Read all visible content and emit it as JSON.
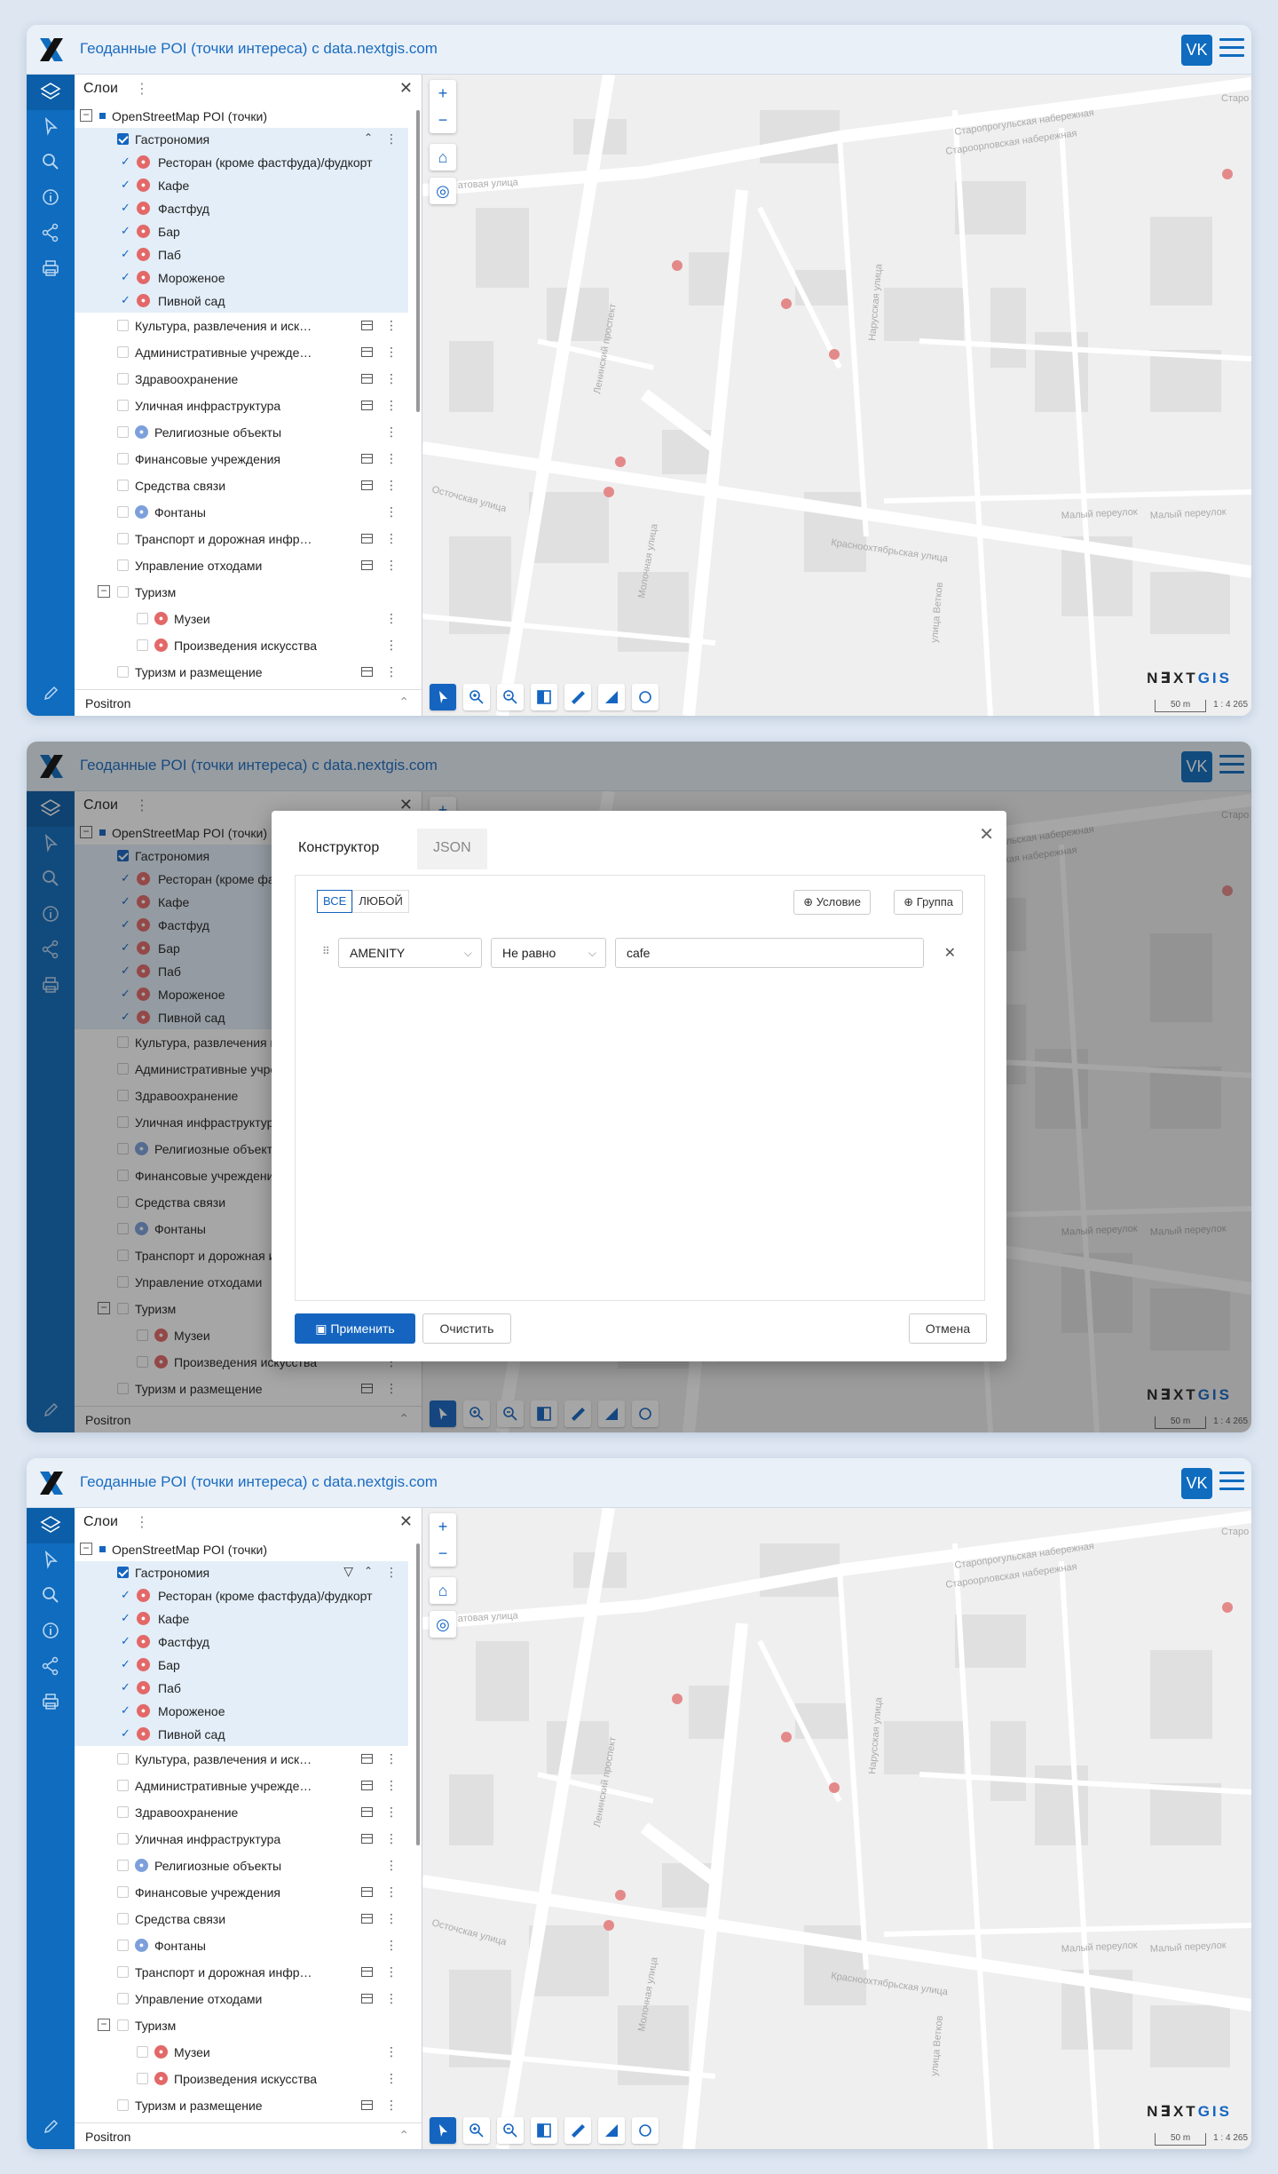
{
  "app": {
    "title": "Геоданные POI (точки интереса) с data.nextgis.com",
    "vk_label": "VK",
    "brand_color": "#0f6cbf"
  },
  "layers_panel": {
    "title": "Слои",
    "root": "OpenStreetMap POI (точки)",
    "group": "Гастрономия",
    "children": [
      {
        "label": "Ресторан (кроме фастфуда)/фудкорт",
        "icon": "restaurant-icon"
      },
      {
        "label": "Кафе",
        "icon": "cafe-icon"
      },
      {
        "label": "Фастфуд",
        "icon": "fastfood-icon"
      },
      {
        "label": "Бар",
        "icon": "bar-icon"
      },
      {
        "label": "Паб",
        "icon": "pub-icon"
      },
      {
        "label": "Мороженое",
        "icon": "icecream-icon"
      },
      {
        "label": "Пивной сад",
        "icon": "beer-garden-icon"
      }
    ],
    "items": [
      "Культура, развлечения и иск…",
      "Административные учрежде…",
      "Здравоохранение",
      "Уличная инфраструктура",
      "Религиозные объекты",
      "Финансовые учреждения",
      "Средства связи",
      "Фонтаны",
      "Транспорт и дорожная инфр…",
      "Управление отходами",
      "Туризм",
      "Музеи",
      "Произведения искусства",
      "Туризм и размещение"
    ],
    "basemap": "Positron"
  },
  "map": {
    "watermark_a": "N",
    "watermark_b": "∃XT",
    "watermark_c": "GIS",
    "scale_label": "50 m",
    "scale_ratio": "1 : 4 265",
    "streets": [
      "Староорловская набережная",
      "Старопрогульская набережная",
      "Ленинский проспект",
      "Нарусская улица",
      "Красноохтябрьская улица",
      "Малый переулок",
      "Малый переулок",
      "улица Ветков",
      "Осточская улица",
      "Молочная улица",
      "Стаpo",
      "атовая улица"
    ]
  },
  "filter_dialog": {
    "tab_constructor": "Конструктор",
    "tab_json": "JSON",
    "all": "ВСЕ",
    "any": "ЛЮБОЙ",
    "add_condition": "Условие",
    "add_group": "Группа",
    "field": "AMENITY",
    "operator": "Не равно",
    "value": "cafe",
    "apply": "Применить",
    "clear": "Очистить",
    "cancel": "Отмена"
  }
}
